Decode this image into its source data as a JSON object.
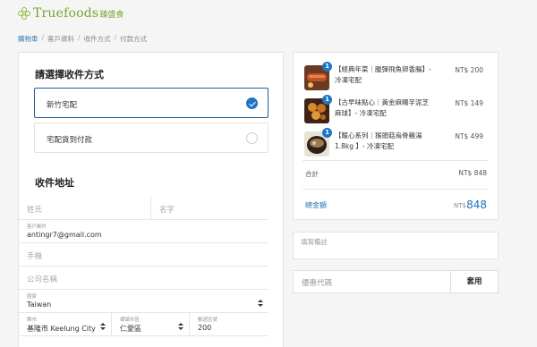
{
  "brand": {
    "name": "Truefoods",
    "sub": "臻盛食"
  },
  "breadcrumb": [
    "購物車",
    "客戶資料",
    "收件方式",
    "付款方式"
  ],
  "shipping": {
    "title": "請選擇收件方式",
    "options": [
      {
        "label": "新竹宅配",
        "selected": true
      },
      {
        "label": "宅配貨到付款",
        "selected": false
      }
    ]
  },
  "address": {
    "title": "收件地址",
    "last_name_placeholder": "姓氏",
    "first_name_placeholder": "名字",
    "email_label": "客戶郵件",
    "email_value": "antingr7@gmail.com",
    "phone_placeholder": "手機",
    "company_placeholder": "公司名稱",
    "country_label": "國家",
    "country_value": "Taiwan",
    "city_label": "縣市",
    "city_value": "基隆市 Keelung City",
    "district_label": "鄉鎮市區",
    "district_value": "仁愛區",
    "zip_label": "郵遞區號",
    "zip_value": "200"
  },
  "order": {
    "items": [
      {
        "qty": "1",
        "name": "【經典年菜｜臘彈飛魚卵香腸】- 冷凍宅配",
        "price": "NT$ 200"
      },
      {
        "qty": "1",
        "name": "【古早味點心｜黃金麻糬芋泥芝麻球】- 冷凍宅配",
        "price": "NT$ 149"
      },
      {
        "qty": "1",
        "name": "【暖心系列｜猴頭菇烏骨雞湯 1.8kg 】- 冷凍宅配",
        "price": "NT$ 499"
      }
    ],
    "subtotal_label": "合計",
    "subtotal_value": "NT$ 848",
    "total_label": "總金額",
    "total_currency": "NT$",
    "total_value": "848"
  },
  "note": {
    "placeholder": "填寫備註"
  },
  "coupon": {
    "placeholder": "優惠代碼",
    "apply_label": "套用"
  },
  "colors": {
    "accent": "#1f74c6",
    "brand": "#7aa432"
  }
}
